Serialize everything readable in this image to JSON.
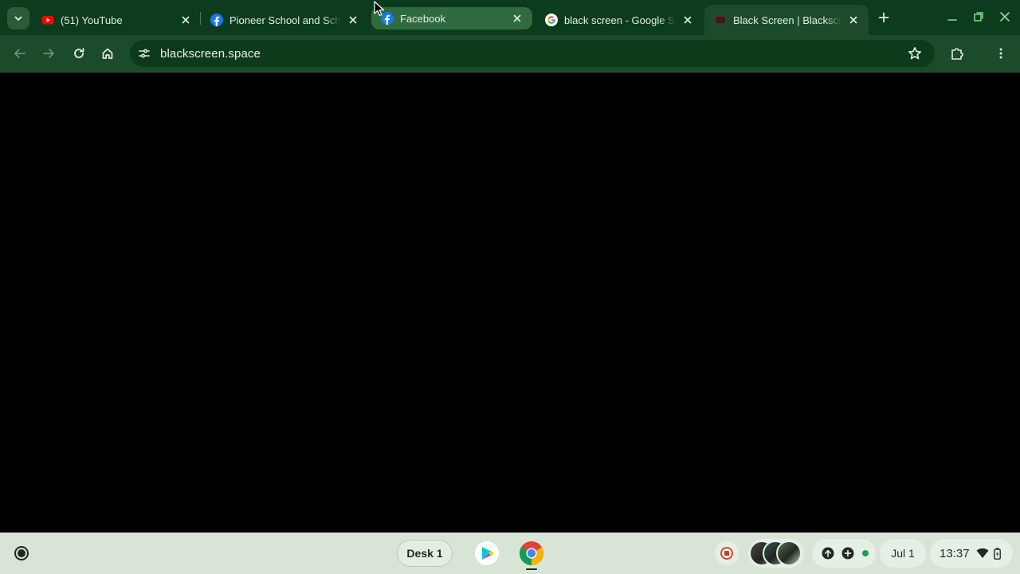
{
  "browser": {
    "tabs": [
      {
        "title": "(51) YouTube",
        "favicon": "youtube-icon",
        "state": "normal"
      },
      {
        "title": "Pioneer School and School",
        "favicon": "facebook-icon",
        "state": "normal"
      },
      {
        "title": "Facebook",
        "favicon": "facebook-icon",
        "state": "hover"
      },
      {
        "title": "black screen - Google Search",
        "favicon": "google-icon",
        "state": "normal"
      },
      {
        "title": "Black Screen | Blackscreen",
        "favicon": "blackscreen-favicon",
        "state": "active"
      }
    ],
    "address": "blackscreen.space",
    "colors": {
      "frame": "#0d3b1e",
      "toolbar": "#1b4b2a",
      "omnibox": "#0e3a1c",
      "page": "#000000",
      "shelf": "#d7e4d6"
    }
  },
  "shelf": {
    "desk_label": "Desk 1",
    "apps": [
      "play-store-icon",
      "chrome-icon"
    ],
    "date": "Jul 1",
    "time": "13:37"
  }
}
